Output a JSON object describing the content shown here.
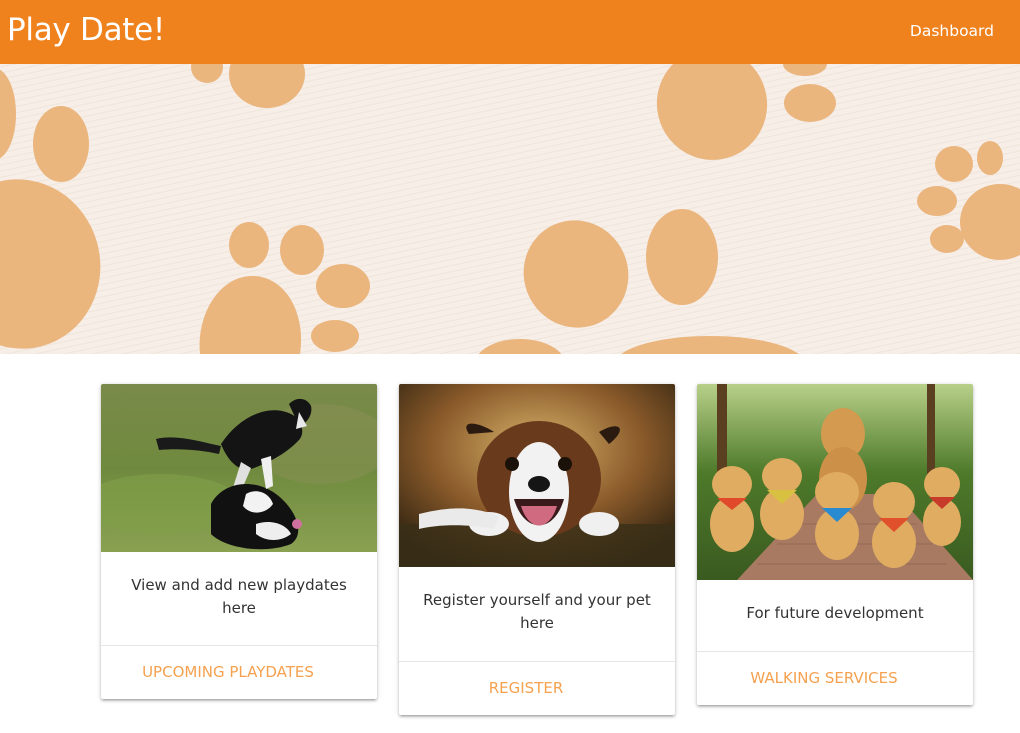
{
  "navbar": {
    "brand": "Play Date!",
    "dashboard_link": "Dashboard",
    "color": "#f0821e"
  },
  "hero": {
    "background_color": "#f6eee7",
    "paw_color": "#ebb57e",
    "icon": "paw-print-pattern"
  },
  "cards": [
    {
      "image": "dogs-playing-on-grass-photo",
      "text": "View and add new playdates here",
      "action": "UPCOMING PLAYDATES"
    },
    {
      "image": "happy-collie-dog-photo",
      "text": "Register yourself and your pet here",
      "action": "REGISTER"
    },
    {
      "image": "golden-retriever-puppies-walking-photo",
      "text": "For future development",
      "action": "WALKING SERVICES"
    }
  ],
  "accent_text_color": "#f5a14f"
}
